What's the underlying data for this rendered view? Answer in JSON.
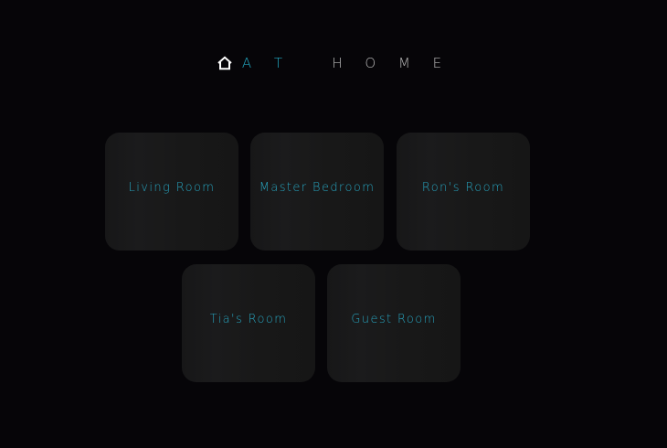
{
  "header": {
    "icon": "home-icon",
    "accent_text": "A T",
    "rest_text": "H O M E"
  },
  "rooms": [
    {
      "label": "Living Room"
    },
    {
      "label": "Master Bedroom"
    },
    {
      "label": "Ron's Room"
    },
    {
      "label": "Tia's Room"
    },
    {
      "label": "Guest Room"
    }
  ],
  "colors": {
    "background": "#060508",
    "accent": "#22a6c0",
    "tile": "#1a1a1b",
    "title_rest": "#b9b9b9"
  }
}
